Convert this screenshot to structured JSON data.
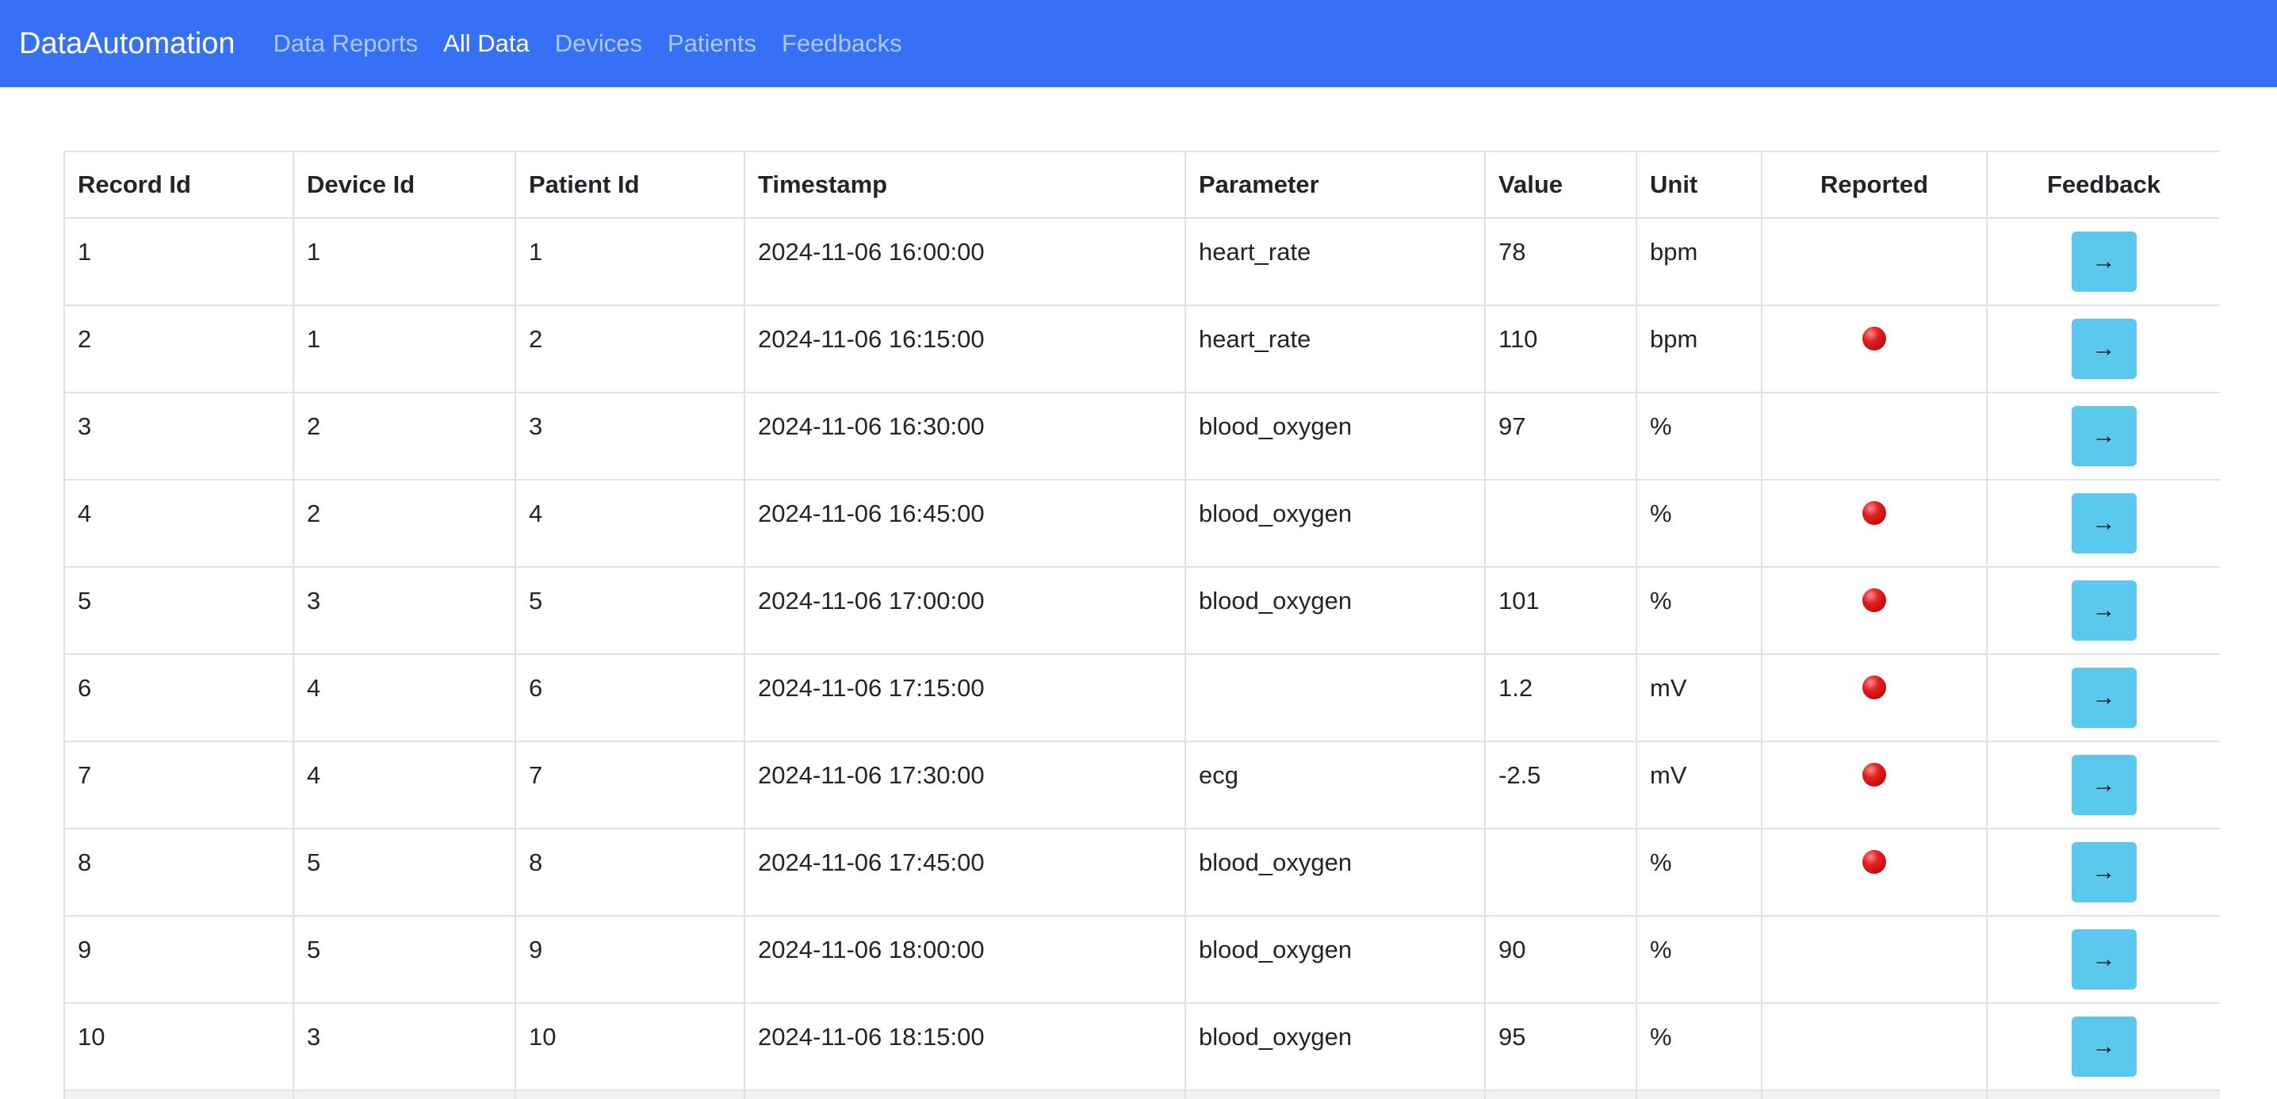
{
  "navbar": {
    "brand": "DataAutomation",
    "links": [
      {
        "label": "Data Reports",
        "active": false
      },
      {
        "label": "All Data",
        "active": true
      },
      {
        "label": "Devices",
        "active": false
      },
      {
        "label": "Patients",
        "active": false
      },
      {
        "label": "Feedbacks",
        "active": false
      }
    ]
  },
  "colors": {
    "navbar_bg": "#3570f5",
    "feedback_button_bg": "#5bc8ed",
    "reported_dot": "#e02020"
  },
  "table": {
    "headers": [
      "Record Id",
      "Device Id",
      "Patient Id",
      "Timestamp",
      "Parameter",
      "Value",
      "Unit",
      "Reported",
      "Feedback"
    ],
    "feedback_button_icon": "arrow-right-icon",
    "feedback_button_glyph": "→",
    "reported_icon": "red-circle-icon",
    "rows": [
      {
        "record_id": "1",
        "device_id": "1",
        "patient_id": "1",
        "timestamp": "2024-11-06 16:00:00",
        "parameter": "heart_rate",
        "value": "78",
        "unit": "bpm",
        "reported": false
      },
      {
        "record_id": "2",
        "device_id": "1",
        "patient_id": "2",
        "timestamp": "2024-11-06 16:15:00",
        "parameter": "heart_rate",
        "value": "110",
        "unit": "bpm",
        "reported": true
      },
      {
        "record_id": "3",
        "device_id": "2",
        "patient_id": "3",
        "timestamp": "2024-11-06 16:30:00",
        "parameter": "blood_oxygen",
        "value": "97",
        "unit": "%",
        "reported": false
      },
      {
        "record_id": "4",
        "device_id": "2",
        "patient_id": "4",
        "timestamp": "2024-11-06 16:45:00",
        "parameter": "blood_oxygen",
        "value": "",
        "unit": "%",
        "reported": true
      },
      {
        "record_id": "5",
        "device_id": "3",
        "patient_id": "5",
        "timestamp": "2024-11-06 17:00:00",
        "parameter": "blood_oxygen",
        "value": "101",
        "unit": "%",
        "reported": true
      },
      {
        "record_id": "6",
        "device_id": "4",
        "patient_id": "6",
        "timestamp": "2024-11-06 17:15:00",
        "parameter": "",
        "value": "1.2",
        "unit": "mV",
        "reported": true
      },
      {
        "record_id": "7",
        "device_id": "4",
        "patient_id": "7",
        "timestamp": "2024-11-06 17:30:00",
        "parameter": "ecg",
        "value": "-2.5",
        "unit": "mV",
        "reported": true
      },
      {
        "record_id": "8",
        "device_id": "5",
        "patient_id": "8",
        "timestamp": "2024-11-06 17:45:00",
        "parameter": "blood_oxygen",
        "value": "",
        "unit": "%",
        "reported": true
      },
      {
        "record_id": "9",
        "device_id": "5",
        "patient_id": "9",
        "timestamp": "2024-11-06 18:00:00",
        "parameter": "blood_oxygen",
        "value": "90",
        "unit": "%",
        "reported": false
      },
      {
        "record_id": "10",
        "device_id": "3",
        "patient_id": "10",
        "timestamp": "2024-11-06 18:15:00",
        "parameter": "blood_oxygen",
        "value": "95",
        "unit": "%",
        "reported": false
      }
    ]
  }
}
